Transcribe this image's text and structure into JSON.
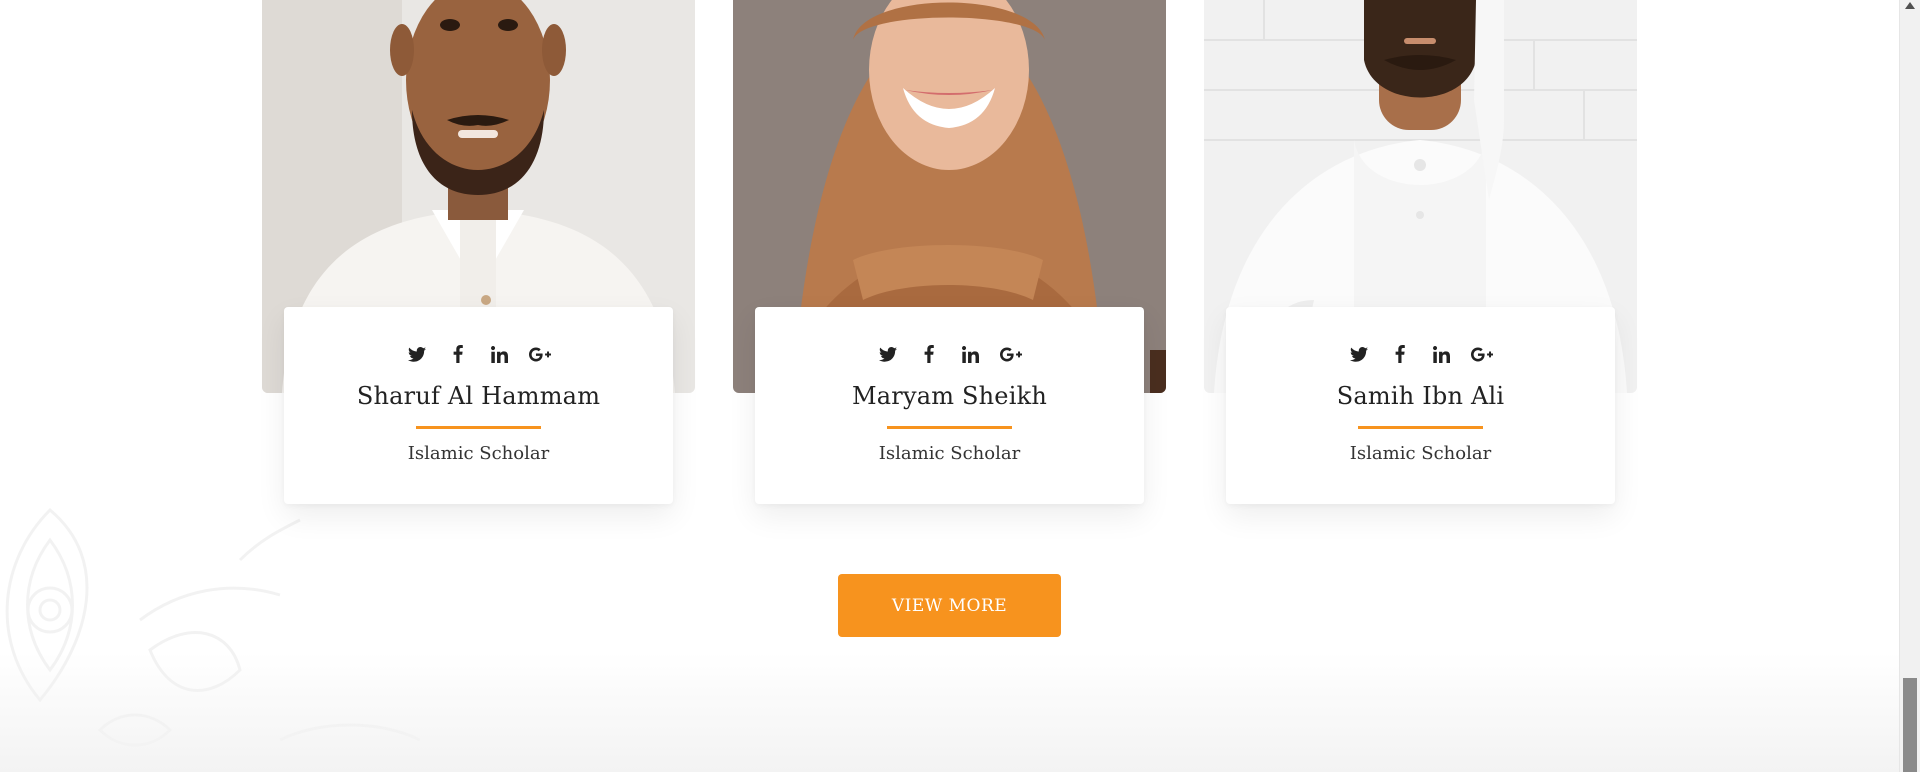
{
  "team": {
    "members": [
      {
        "name": "Sharuf Al Hammam",
        "role": "Islamic Scholar",
        "photo": "portrait-man-white-thobe"
      },
      {
        "name": "Maryam Sheikh",
        "role": "Islamic Scholar",
        "photo": "portrait-woman-brown-hijab"
      },
      {
        "name": "Samih Ibn Ali",
        "role": "Islamic Scholar",
        "photo": "portrait-man-white-ghutra"
      }
    ],
    "social_icons": [
      "twitter-icon",
      "facebook-icon",
      "linkedin-icon",
      "google-plus-icon"
    ]
  },
  "actions": {
    "view_more_label": "VIEW MORE"
  },
  "colors": {
    "accent": "#f7931e",
    "text_dark": "#222222",
    "card_bg": "#ffffff"
  }
}
